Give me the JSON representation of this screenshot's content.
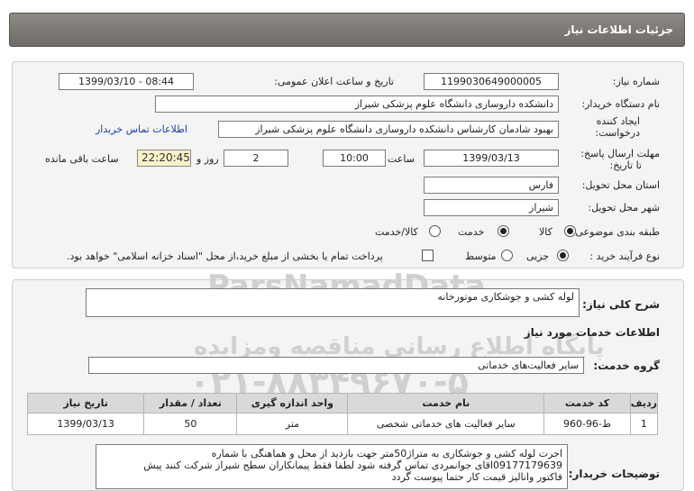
{
  "header": {
    "title": "جزئیات اطلاعات نیاز"
  },
  "details": {
    "need_number_label": "شماره نیاز:",
    "need_number": "1199030649000005",
    "announce_label": "تاریخ و ساعت اعلان عمومی:",
    "announce_value": "1399/03/10 - 08:44",
    "buyer_label": "نام دستگاه خریدار:",
    "buyer_value": "دانشکده داروسازی دانشگاه علوم پزشکی شیراز",
    "creator_label_1": "ایجاد کننده",
    "creator_label_2": "درخواست:",
    "creator_value": "بهبود  شادمان  کارشناس   دانشکده داروسازی دانشگاه علوم پزشکی شیراز",
    "contact_link": "اطلاعات تماس خریدار",
    "deadline_label_1": "مهلت ارسال پاسخ:",
    "deadline_label_2": "تا تاریخ:",
    "deadline_date": "1399/03/13",
    "hour_label": "ساعت",
    "deadline_time": "10:00",
    "days_value": "2",
    "days_label": "روز و",
    "remaining_time": "22:20:45",
    "remaining_label": "ساعت باقی مانده",
    "province_label": "استان محل تحویل:",
    "province_value": "فارس",
    "city_label": "شهر محل تحویل:",
    "city_value": "شیراز",
    "category_label": "طبقه بندی موضوعی:",
    "category_options": [
      "کالا",
      "خدمت",
      "کالا/خدمت"
    ],
    "process_label": "نوع فرآیند خرید :",
    "process_options": [
      "جزیی",
      "متوسط"
    ],
    "payment_note": "پرداخت تمام یا بخشی از مبلغ خرید،از محل \"اسناد خزانه اسلامی\" خواهد بود."
  },
  "summary": {
    "label": "شرح کلی نیاز:",
    "value": "لوله کشی و جوشکاری موتورخانه"
  },
  "services": {
    "section_title": "اطلاعات خدمات مورد نیاز",
    "group_label": "گروه خدمت:",
    "group_value": "سایر فعالیت‌های خدماتی",
    "columns": [
      "ردیف",
      "کد خدمت",
      "نام خدمت",
      "واحد اندازه گیری",
      "تعداد / مقدار",
      "تاریخ نیاز"
    ],
    "rows": [
      [
        "1",
        "ط-96-960",
        "سایر فعالیت های خدماتی شخصی",
        "متر",
        "50",
        "1399/03/13"
      ]
    ]
  },
  "buyer_notes": {
    "label": "توضیحات خریدار:",
    "lines": [
      "اجرت لوله کشی و جوشکاری به متراژ50متر جهت بازدید از محل و هماهنگی با شماره",
      "09177179639اقای جوانمردی تماس گرفته شود لطفا فقط پیمانکاران سطح شیراز شرکت کنند پیش",
      "فاکتور وانالیز قیمت کار حتما پیوست گردد"
    ]
  },
  "watermark": {
    "brand": "ParsNamadData",
    "tagline": "پایگاه اطلاع رسانی مناقصه ومزایده",
    "phone": "۰۲۱-۸۸۳۴۹۶۷۰-۵"
  },
  "colors": {
    "header_bg": "#7d7a75",
    "timer_bg": "#f7f2c8",
    "link": "#1a3fa8"
  }
}
